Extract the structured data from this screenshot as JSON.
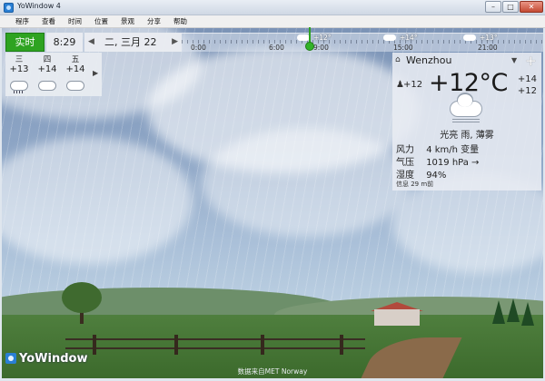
{
  "window": {
    "title": "YoWindow 4"
  },
  "menu": [
    "程序",
    "查看",
    "时间",
    "位置",
    "景观",
    "分享",
    "帮助"
  ],
  "toolbar": {
    "now_label": "实时",
    "time": "8:29",
    "date": "二, 三月 22"
  },
  "timeline": {
    "temps": [
      {
        "value": "+12°",
        "icon": "cloud-icon"
      },
      {
        "value": "+14°",
        "icon": "cloud-icon"
      },
      {
        "value": "+13°",
        "icon": "cloud-icon"
      }
    ],
    "ticks": [
      "0:00",
      "6:00",
      "9:00",
      "15:00",
      "21:00"
    ]
  },
  "forecast": [
    {
      "day": "三",
      "temp": "+13",
      "icon": "rain-cloud-icon"
    },
    {
      "day": "四",
      "temp": "+14",
      "icon": "cloud-icon"
    },
    {
      "day": "五",
      "temp": "+14",
      "icon": "cloud-icon"
    }
  ],
  "current": {
    "location": "Wenzhou",
    "feels_like": "+12",
    "temperature": "+12°C",
    "high": "+14",
    "low": "+12",
    "description": "光亮 雨, 薄雾",
    "wind_label": "风力",
    "wind_value": "4 km/h 变量",
    "pressure_label": "气压",
    "pressure_value": "1019 hPa →",
    "humidity_label": "湿度",
    "humidity_value": "94%",
    "updated": "信息 29 m前",
    "icon": "fog-cloud-icon"
  },
  "brand": "YoWindow",
  "credit": "数据来自MET Norway",
  "colors": {
    "now_button": "#2ea321",
    "logo": "#2a7fd4"
  }
}
